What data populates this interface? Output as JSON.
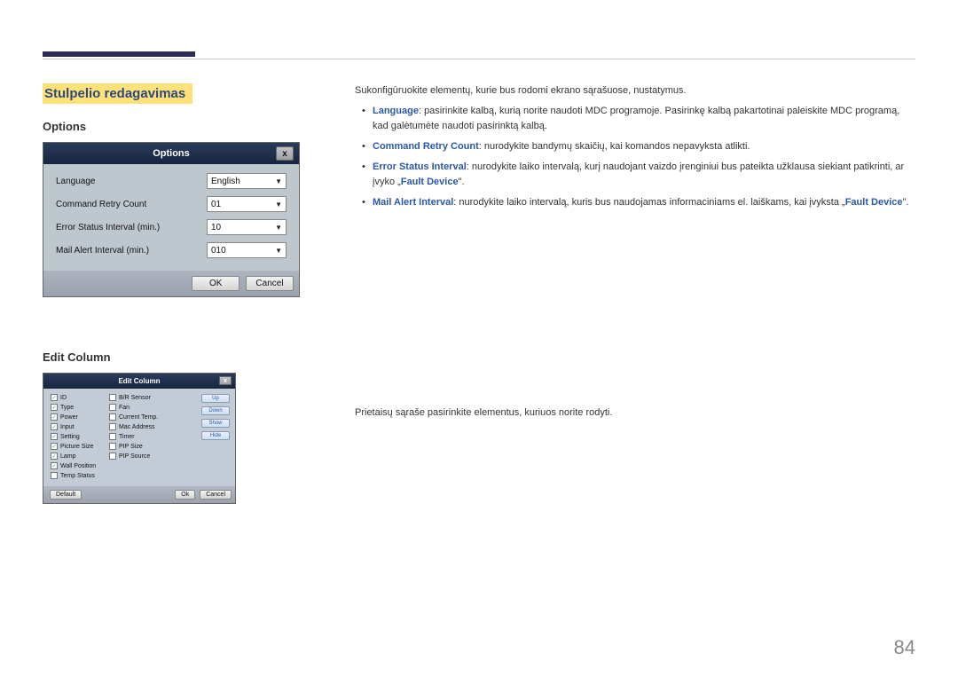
{
  "header": {
    "section_title": "Stulpelio redagavimas"
  },
  "left": {
    "options_heading": "Options",
    "edit_column_heading": "Edit Column",
    "options_dialog": {
      "title": "Options",
      "close": "x",
      "rows": {
        "language_label": "Language",
        "language_value": "English",
        "retry_label": "Command Retry Count",
        "retry_value": "01",
        "error_label": "Error Status Interval (min.)",
        "error_value": "10",
        "mail_label": "Mail Alert Interval (min.)",
        "mail_value": "010"
      },
      "ok": "OK",
      "cancel": "Cancel"
    },
    "edit_dialog": {
      "title": "Edit Column",
      "close": "x",
      "col1": [
        "ID",
        "Type",
        "Power",
        "Input",
        "Setting",
        "Picture Size",
        "Lamp",
        "Wall Position",
        "Temp Status"
      ],
      "col1_checked": [
        true,
        true,
        true,
        true,
        true,
        true,
        true,
        true,
        false
      ],
      "col2": [
        "B/R Sensor",
        "Fan",
        "Current Temp.",
        "Mac Address",
        "Timer",
        "PIP Size",
        "PIP Source"
      ],
      "col2_checked": [
        false,
        false,
        false,
        false,
        false,
        false,
        false
      ],
      "side": [
        "Up",
        "Down",
        "Show",
        "Hide"
      ],
      "default": "Default",
      "ok": "Ok",
      "cancel": "Cancel"
    }
  },
  "right": {
    "intro": "Sukonfigūruokite elementų, kurie bus rodomi ekrano sąrašuose, nustatymus.",
    "b1_label": "Language",
    "b1_text": ": pasirinkite kalbą, kurią norite naudoti MDC programoje. Pasirinkę kalbą pakartotinai paleiskite MDC programą, kad galėtumėte naudoti pasirinktą kalbą.",
    "b2_label": "Command Retry Count",
    "b2_text": ": nurodykite bandymų skaičių, kai komandos nepavyksta atlikti.",
    "b3_label": "Error Status Interval",
    "b3_text_a": ": nurodykite laiko intervalą, kurį naudojant vaizdo įrenginiui bus pateikta užklausa siekiant patikrinti, ar įvyko „",
    "b3_fault": "Fault Device",
    "b3_close": "\".",
    "b4_label": "Mail Alert Interval",
    "b4_text_a": ": nurodykite laiko intervalą, kuris bus naudojamas informaciniams el. laiškams, kai įvyksta „",
    "b4_fault": "Fault Device",
    "b4_close": "\".",
    "editcol_text": "Prietaisų sąraše pasirinkite elementus, kuriuos norite rodyti."
  },
  "page_number": "84"
}
